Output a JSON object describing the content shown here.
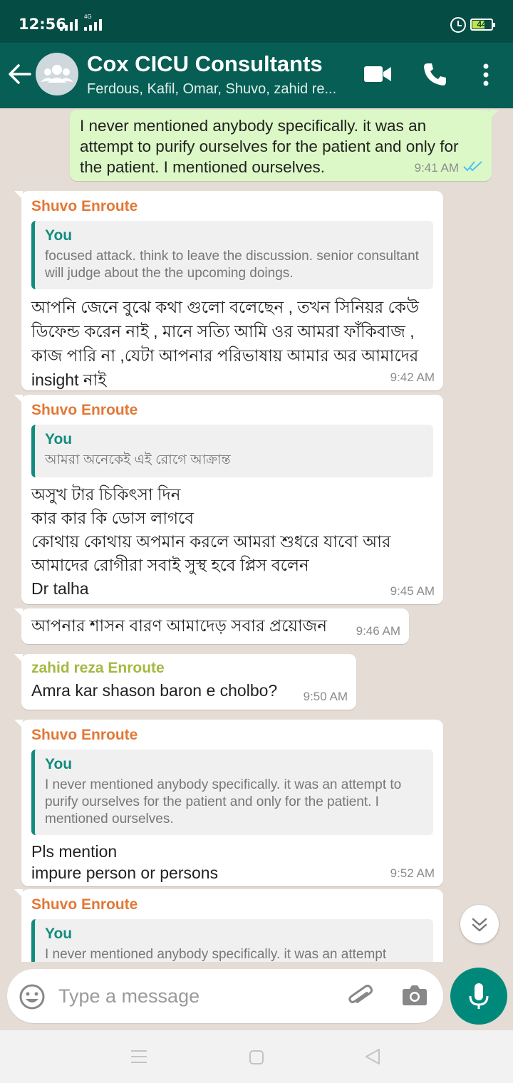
{
  "status_bar": {
    "time": "12:56",
    "network": "4G",
    "battery": "44"
  },
  "header": {
    "title": "Cox CICU Consultants",
    "subtitle": "Ferdous, Kafil, Omar, Shuvo, zahid re..."
  },
  "icons": {
    "back": "arrow-left-icon",
    "avatar": "group-avatar-icon",
    "video": "video-call-icon",
    "phone": "phone-call-icon",
    "menu": "more-vertical-icon",
    "scroll": "chevron-double-down-icon",
    "emoji": "emoji-icon",
    "attach": "paperclip-icon",
    "camera": "camera-icon",
    "mic": "microphone-icon"
  },
  "colors": {
    "header": "#075e54",
    "outgoing_bubble": "#dcf8c6",
    "incoming_bubble": "#ffffff",
    "read_ticks": "#4fc3f7",
    "accent": "#00897b"
  },
  "messages": [
    {
      "direction": "out",
      "text": "I never mentioned anybody specifically. it was an attempt to purify ourselves for the patient and only for the patient. I mentioned ourselves.",
      "time": "9:41 AM",
      "status": "read"
    },
    {
      "direction": "in",
      "sender": "Shuvo Enroute",
      "quote_name": "You",
      "quote_text": "focused attack. think to leave the discussion. senior consultant will judge about the the upcoming doings.",
      "lines": [
        "আপনি জেনে বুঝে কথা গুলো বলেছেন , তখন সিনিয়র কেউ",
        "ডিফেন্ড করেন নাই , মানে সত্যি আমি ওর আমরা ফাঁকিবাজ ,",
        "কাজ পারি না ,যেটা আপনার পরিভাষায় আমার অর আমাদের",
        "insight নাই"
      ],
      "time": "9:42 AM"
    },
    {
      "direction": "in",
      "sender": "Shuvo Enroute",
      "quote_name": "You",
      "quote_text": "আমরা অনেকেই এই রোগে আক্রান্ত",
      "lines": [
        "অসুখ টার চিকিৎসা দিন",
        "কার কার কি ডোস লাগবে",
        "কোথায় কোথায় অপমান করলে আমরা শুধরে যাবো আর",
        "আমাদের রোগীরা সবাই সুস্থ হবে প্লিস বলেন",
        "Dr talha"
      ],
      "time": "9:45 AM"
    },
    {
      "direction": "in",
      "text": "আপনার শাসন বারণ আমাদেড় সবার প্রয়োজন",
      "time": "9:46 AM"
    },
    {
      "direction": "in",
      "sender": "zahid reza Enroute",
      "text": "Amra kar shason baron e cholbo?",
      "time": "9:50 AM"
    },
    {
      "direction": "in",
      "sender": "Shuvo Enroute",
      "quote_name": "You",
      "quote_text": "I never mentioned anybody specifically. it was an attempt to purify ourselves for the patient and only for the patient. I mentioned ourselves.",
      "lines": [
        "Pls mention",
        "impure person or persons"
      ],
      "time": "9:52 AM"
    },
    {
      "direction": "in",
      "sender": "Shuvo Enroute",
      "quote_name": "You",
      "quote_text": "I never mentioned anybody specifically. it was an attempt"
    }
  ],
  "composer": {
    "placeholder": "Type a message"
  }
}
